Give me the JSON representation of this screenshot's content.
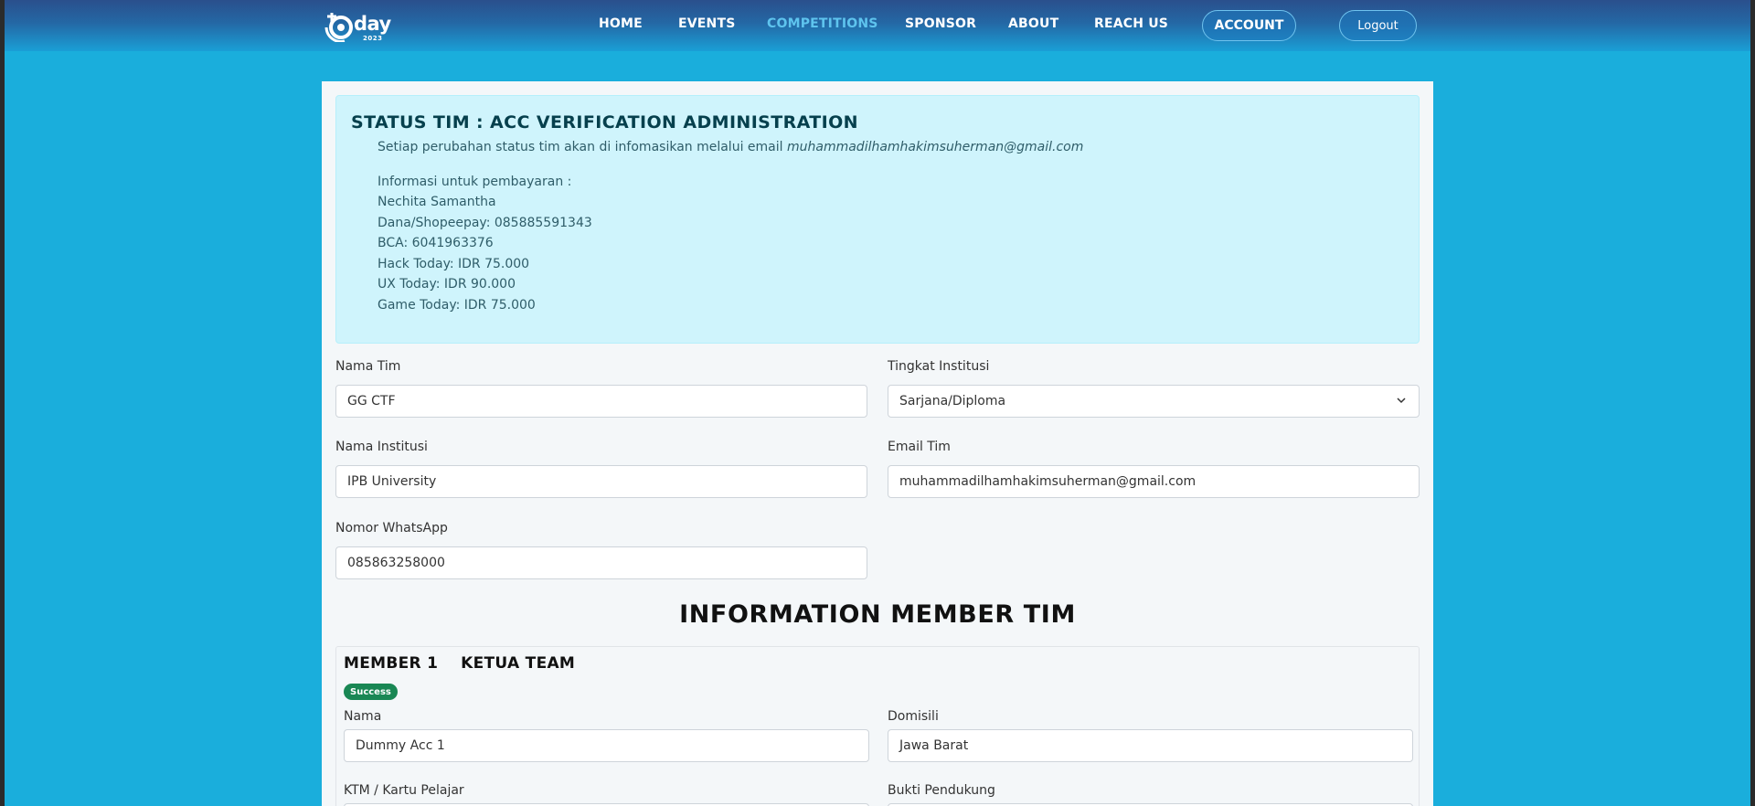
{
  "nav": {
    "logo_text": "day",
    "logo_year": "2023",
    "links": [
      "HOME",
      "EVENTS",
      "COMPETITIONS",
      "SPONSOR",
      "ABOUT",
      "REACH US"
    ],
    "account": "ACCOUNT",
    "logout": "Logout",
    "active_color": "#5ec4ee"
  },
  "status": {
    "title": "STATUS TIM : ACC VERIFICATION ADMINISTRATION",
    "notice": "Setiap perubahan status tim akan di infomasikan melalui email",
    "email": "muhammadilhamhakimsuherman@gmail.com",
    "payment_lines": [
      "Informasi untuk pembayaran :",
      "Nechita Samantha",
      "Dana/Shopeepay: 085885591343",
      "BCA: 6041963376",
      "Hack Today: IDR 75.000",
      "UX Today: IDR 90.000",
      "Game Today: IDR 75.000"
    ]
  },
  "form": {
    "nama_tim": {
      "label": "Nama Tim",
      "value": "GG CTF"
    },
    "tingkat": {
      "label": "Tingkat Institusi",
      "value": "Sarjana/Diploma"
    },
    "institusi": {
      "label": "Nama Institusi",
      "value": "IPB University"
    },
    "email": {
      "label": "Email Tim",
      "value": "muhammadilhamhakimsuherman@gmail.com"
    },
    "whatsapp": {
      "label": "Nomor WhatsApp",
      "value": "085863258000"
    }
  },
  "members": {
    "section_title": "INFORMATION MEMBER TIM",
    "member1": {
      "title": "MEMBER 1    KETUA TEAM",
      "badge": "Success",
      "nama": {
        "label": "Nama",
        "value": "Dummy Acc 1"
      },
      "domisili": {
        "label": "Domisili",
        "value": "Jawa Barat"
      },
      "ktm_label": "KTM / Kartu Pelajar",
      "bukti_label": "Bukti Pendukung"
    }
  },
  "colors": {
    "background": "#1aaedc",
    "alert_bg": "#cff4fc",
    "badge_success": "#198754"
  }
}
